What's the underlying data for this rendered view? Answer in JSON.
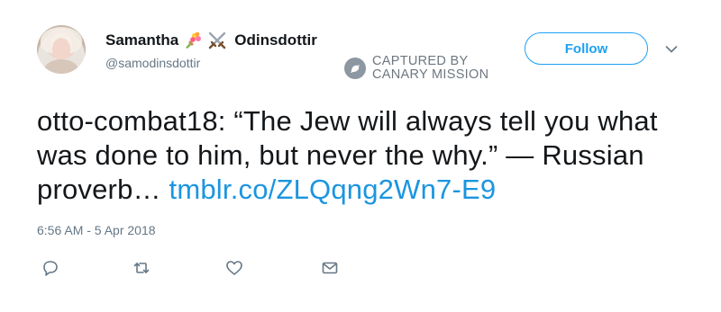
{
  "user": {
    "name_first": "Samantha",
    "name_last": "Odinsdottir",
    "emojis": [
      "bouquet-icon",
      "crossed-swords-icon"
    ],
    "handle": "@samodinsdottir"
  },
  "follow_label": "Follow",
  "watermark": {
    "line1": "CAPTURED BY",
    "line2": "CANARY MISSION"
  },
  "tweet": {
    "text": "otto-combat18: “The Jew will always tell you what was done to him, but never the why.” — Russian proverb… ",
    "link": "tmblr.co/ZLQqng2Wn7-E9"
  },
  "timestamp": "6:56 AM - 5 Apr 2018",
  "actions": [
    "reply-icon",
    "retweet-icon",
    "like-icon",
    "direct-message-icon"
  ],
  "colors": {
    "accent": "#1da1f2",
    "link": "#1b95e0",
    "muted": "#657786",
    "text": "#14171a"
  }
}
